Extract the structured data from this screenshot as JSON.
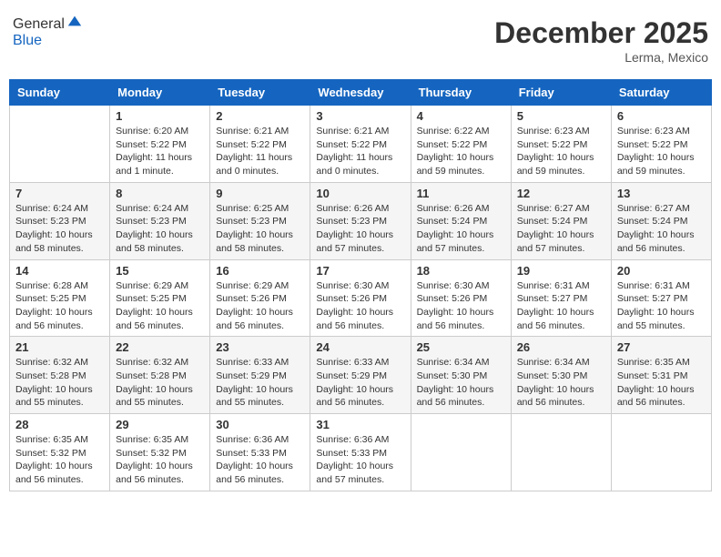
{
  "header": {
    "logo_general": "General",
    "logo_blue": "Blue",
    "month_title": "December 2025",
    "location": "Lerma, Mexico"
  },
  "weekdays": [
    "Sunday",
    "Monday",
    "Tuesday",
    "Wednesday",
    "Thursday",
    "Friday",
    "Saturday"
  ],
  "weeks": [
    [
      {
        "day": "",
        "info": ""
      },
      {
        "day": "1",
        "info": "Sunrise: 6:20 AM\nSunset: 5:22 PM\nDaylight: 11 hours\nand 1 minute."
      },
      {
        "day": "2",
        "info": "Sunrise: 6:21 AM\nSunset: 5:22 PM\nDaylight: 11 hours\nand 0 minutes."
      },
      {
        "day": "3",
        "info": "Sunrise: 6:21 AM\nSunset: 5:22 PM\nDaylight: 11 hours\nand 0 minutes."
      },
      {
        "day": "4",
        "info": "Sunrise: 6:22 AM\nSunset: 5:22 PM\nDaylight: 10 hours\nand 59 minutes."
      },
      {
        "day": "5",
        "info": "Sunrise: 6:23 AM\nSunset: 5:22 PM\nDaylight: 10 hours\nand 59 minutes."
      },
      {
        "day": "6",
        "info": "Sunrise: 6:23 AM\nSunset: 5:22 PM\nDaylight: 10 hours\nand 59 minutes."
      }
    ],
    [
      {
        "day": "7",
        "info": "Sunrise: 6:24 AM\nSunset: 5:23 PM\nDaylight: 10 hours\nand 58 minutes."
      },
      {
        "day": "8",
        "info": "Sunrise: 6:24 AM\nSunset: 5:23 PM\nDaylight: 10 hours\nand 58 minutes."
      },
      {
        "day": "9",
        "info": "Sunrise: 6:25 AM\nSunset: 5:23 PM\nDaylight: 10 hours\nand 58 minutes."
      },
      {
        "day": "10",
        "info": "Sunrise: 6:26 AM\nSunset: 5:23 PM\nDaylight: 10 hours\nand 57 minutes."
      },
      {
        "day": "11",
        "info": "Sunrise: 6:26 AM\nSunset: 5:24 PM\nDaylight: 10 hours\nand 57 minutes."
      },
      {
        "day": "12",
        "info": "Sunrise: 6:27 AM\nSunset: 5:24 PM\nDaylight: 10 hours\nand 57 minutes."
      },
      {
        "day": "13",
        "info": "Sunrise: 6:27 AM\nSunset: 5:24 PM\nDaylight: 10 hours\nand 56 minutes."
      }
    ],
    [
      {
        "day": "14",
        "info": "Sunrise: 6:28 AM\nSunset: 5:25 PM\nDaylight: 10 hours\nand 56 minutes."
      },
      {
        "day": "15",
        "info": "Sunrise: 6:29 AM\nSunset: 5:25 PM\nDaylight: 10 hours\nand 56 minutes."
      },
      {
        "day": "16",
        "info": "Sunrise: 6:29 AM\nSunset: 5:26 PM\nDaylight: 10 hours\nand 56 minutes."
      },
      {
        "day": "17",
        "info": "Sunrise: 6:30 AM\nSunset: 5:26 PM\nDaylight: 10 hours\nand 56 minutes."
      },
      {
        "day": "18",
        "info": "Sunrise: 6:30 AM\nSunset: 5:26 PM\nDaylight: 10 hours\nand 56 minutes."
      },
      {
        "day": "19",
        "info": "Sunrise: 6:31 AM\nSunset: 5:27 PM\nDaylight: 10 hours\nand 56 minutes."
      },
      {
        "day": "20",
        "info": "Sunrise: 6:31 AM\nSunset: 5:27 PM\nDaylight: 10 hours\nand 55 minutes."
      }
    ],
    [
      {
        "day": "21",
        "info": "Sunrise: 6:32 AM\nSunset: 5:28 PM\nDaylight: 10 hours\nand 55 minutes."
      },
      {
        "day": "22",
        "info": "Sunrise: 6:32 AM\nSunset: 5:28 PM\nDaylight: 10 hours\nand 55 minutes."
      },
      {
        "day": "23",
        "info": "Sunrise: 6:33 AM\nSunset: 5:29 PM\nDaylight: 10 hours\nand 55 minutes."
      },
      {
        "day": "24",
        "info": "Sunrise: 6:33 AM\nSunset: 5:29 PM\nDaylight: 10 hours\nand 56 minutes."
      },
      {
        "day": "25",
        "info": "Sunrise: 6:34 AM\nSunset: 5:30 PM\nDaylight: 10 hours\nand 56 minutes."
      },
      {
        "day": "26",
        "info": "Sunrise: 6:34 AM\nSunset: 5:30 PM\nDaylight: 10 hours\nand 56 minutes."
      },
      {
        "day": "27",
        "info": "Sunrise: 6:35 AM\nSunset: 5:31 PM\nDaylight: 10 hours\nand 56 minutes."
      }
    ],
    [
      {
        "day": "28",
        "info": "Sunrise: 6:35 AM\nSunset: 5:32 PM\nDaylight: 10 hours\nand 56 minutes."
      },
      {
        "day": "29",
        "info": "Sunrise: 6:35 AM\nSunset: 5:32 PM\nDaylight: 10 hours\nand 56 minutes."
      },
      {
        "day": "30",
        "info": "Sunrise: 6:36 AM\nSunset: 5:33 PM\nDaylight: 10 hours\nand 56 minutes."
      },
      {
        "day": "31",
        "info": "Sunrise: 6:36 AM\nSunset: 5:33 PM\nDaylight: 10 hours\nand 57 minutes."
      },
      {
        "day": "",
        "info": ""
      },
      {
        "day": "",
        "info": ""
      },
      {
        "day": "",
        "info": ""
      }
    ]
  ]
}
